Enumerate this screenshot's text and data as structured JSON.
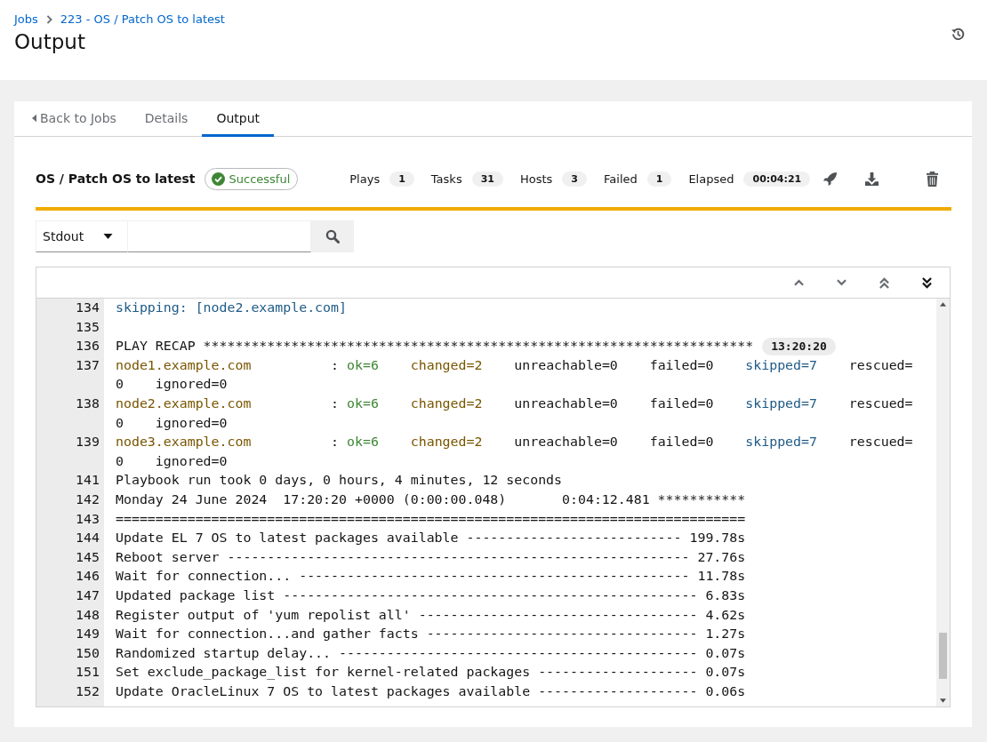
{
  "breadcrumb": [
    "Jobs",
    "223 - OS / Patch OS to latest"
  ],
  "page_title": "Output",
  "tabs": [
    {
      "label": "Back to Jobs",
      "kind": "back",
      "selected": false
    },
    {
      "label": "Details",
      "kind": "tab",
      "selected": false
    },
    {
      "label": "Output",
      "kind": "tab",
      "selected": true
    }
  ],
  "job": {
    "name": "OS / Patch OS to latest",
    "status": {
      "label": "Successful",
      "kind": "success"
    }
  },
  "stats": [
    {
      "label": "Plays",
      "count": "1"
    },
    {
      "label": "Tasks",
      "count": "31"
    },
    {
      "label": "Hosts",
      "count": "3"
    },
    {
      "label": "Failed",
      "count": "1"
    },
    {
      "label": "Elapsed",
      "count": "00:04:21"
    }
  ],
  "progress": {
    "level": 1
  },
  "filter": {
    "value": "Stdout"
  },
  "log": [
    {
      "number": "134",
      "segments": [
        {
          "kind": "skipped",
          "text": "skipping: [node2.example.com]"
        }
      ]
    },
    {
      "number": "135"
    },
    {
      "number": "136",
      "segments": [
        {
          "kind": "plain",
          "text": "PLAY RECAP *********************************************************************"
        }
      ],
      "timestamp": "13:20:20"
    },
    {
      "number": "137",
      "segments": [
        {
          "kind": "host",
          "text": "node1.example.com"
        },
        {
          "kind": "plain",
          "text": "          : "
        },
        {
          "kind": "ok",
          "text": "ok=6    "
        },
        {
          "kind": "changed",
          "text": "changed=2"
        },
        {
          "kind": "plain",
          "text": "    unreachable=0    failed=0    "
        },
        {
          "kind": "skipped",
          "text": "skipped=7"
        },
        {
          "kind": "plain",
          "text": "    rescued=0    ignored=0"
        }
      ]
    },
    {
      "number": "138",
      "segments": [
        {
          "kind": "host",
          "text": "node2.example.com"
        },
        {
          "kind": "plain",
          "text": "          : "
        },
        {
          "kind": "ok",
          "text": "ok=6    "
        },
        {
          "kind": "changed",
          "text": "changed=2"
        },
        {
          "kind": "plain",
          "text": "    unreachable=0    failed=0    "
        },
        {
          "kind": "skipped",
          "text": "skipped=7"
        },
        {
          "kind": "plain",
          "text": "    rescued=0    ignored=0"
        }
      ]
    },
    {
      "number": "139",
      "segments": [
        {
          "kind": "host",
          "text": "node3.example.com"
        },
        {
          "kind": "plain",
          "text": "          : "
        },
        {
          "kind": "ok",
          "text": "ok=6    "
        },
        {
          "kind": "changed",
          "text": "changed=2"
        },
        {
          "kind": "plain",
          "text": "    unreachable=0    failed=0    "
        },
        {
          "kind": "skipped",
          "text": "skipped=7"
        },
        {
          "kind": "plain",
          "text": "    rescued=0    ignored=0"
        }
      ]
    },
    {
      "number": "141",
      "segments": [
        {
          "kind": "plain",
          "text": "Playbook run took 0 days, 0 hours, 4 minutes, 12 seconds"
        }
      ]
    },
    {
      "number": "142",
      "segments": [
        {
          "kind": "plain",
          "text": "Monday 24 June 2024  17:20:20 +0000 (0:00:00.048)       0:04:12.481 ***********"
        }
      ]
    },
    {
      "number": "143",
      "segments": [
        {
          "kind": "plain",
          "text": "==============================================================================="
        }
      ]
    },
    {
      "number": "144",
      "segments": [
        {
          "kind": "plain",
          "text": "Update EL 7 OS to latest packages available --------------------------- 199.78s"
        }
      ]
    },
    {
      "number": "145",
      "segments": [
        {
          "kind": "plain",
          "text": "Reboot server ---------------------------------------------------------- 27.76s"
        }
      ]
    },
    {
      "number": "146",
      "segments": [
        {
          "kind": "plain",
          "text": "Wait for connection... ------------------------------------------------- 11.78s"
        }
      ]
    },
    {
      "number": "147",
      "segments": [
        {
          "kind": "plain",
          "text": "Updated package list ---------------------------------------------------- 6.83s"
        }
      ]
    },
    {
      "number": "148",
      "segments": [
        {
          "kind": "plain",
          "text": "Register output of 'yum repolist all' ----------------------------------- 4.62s"
        }
      ]
    },
    {
      "number": "149",
      "segments": [
        {
          "kind": "plain",
          "text": "Wait for connection...and gather facts ---------------------------------- 1.27s"
        }
      ]
    },
    {
      "number": "150",
      "segments": [
        {
          "kind": "plain",
          "text": "Randomized startup delay... --------------------------------------------- 0.07s"
        }
      ]
    },
    {
      "number": "151",
      "segments": [
        {
          "kind": "plain",
          "text": "Set exclude_package_list for kernel-related packages -------------------- 0.07s"
        }
      ]
    },
    {
      "number": "152",
      "segments": [
        {
          "kind": "plain",
          "text": "Update OracleLinux 7 OS to latest packages available -------------------- 0.06s"
        }
      ]
    }
  ]
}
